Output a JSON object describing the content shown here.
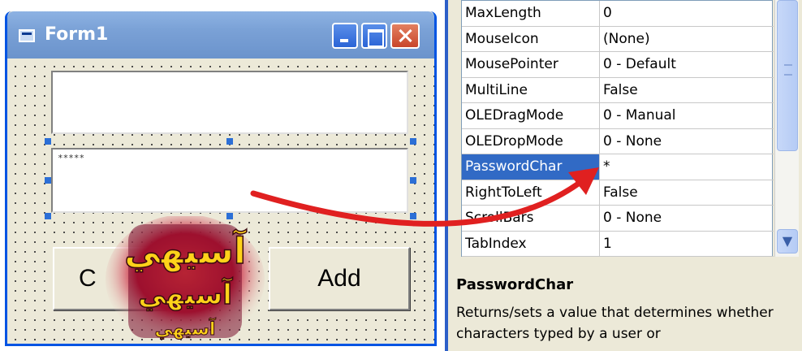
{
  "form_window": {
    "title": "Form1",
    "textbox2_value": "*****",
    "buttons": {
      "left_label": "C",
      "add_label": "Add"
    }
  },
  "logo": {
    "text_line1": "آسيهي",
    "text_line2": "آسيهي",
    "text_line3": "آسيهي"
  },
  "properties": {
    "rows": [
      {
        "name": "MaxLength",
        "value": "0"
      },
      {
        "name": "MouseIcon",
        "value": "(None)"
      },
      {
        "name": "MousePointer",
        "value": "0 - Default"
      },
      {
        "name": "MultiLine",
        "value": "False"
      },
      {
        "name": "OLEDragMode",
        "value": "0 - Manual"
      },
      {
        "name": "OLEDropMode",
        "value": "0 - None"
      },
      {
        "name": "PasswordChar",
        "value": "*"
      },
      {
        "name": "RightToLeft",
        "value": "False"
      },
      {
        "name": "ScrollBars",
        "value": "0 - None"
      },
      {
        "name": "TabIndex",
        "value": "1"
      }
    ],
    "selected_row": "PasswordChar",
    "description_title": "PasswordChar",
    "description_text": "Returns/sets a value that determines whether characters typed by a user or"
  },
  "colors": {
    "title_bar": "#7aa1d6",
    "selection": "#316ac5",
    "arrow": "#e02020",
    "handles": "#2c6fd6"
  }
}
